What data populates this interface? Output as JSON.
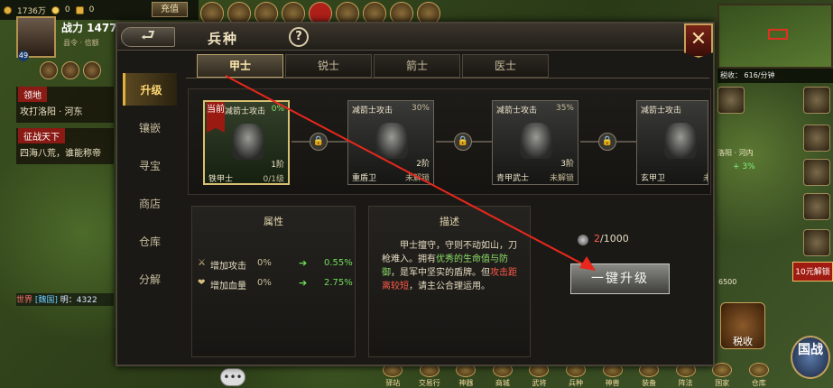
{
  "hud": {
    "silver": "1736万",
    "gold": "0",
    "ingot": "0",
    "recharge_label": "充值",
    "power_label": "战力 1477",
    "official": "县令 · 倍额",
    "level": "49"
  },
  "quests": [
    {
      "title": "领地",
      "text": "攻打洛阳 · 河东"
    },
    {
      "title": "征战天下",
      "text": "四海八荒，谁能称帝"
    }
  ],
  "chat": {
    "tag": "世界",
    "realm": "[魏国]",
    "text": "明：4322"
  },
  "right": {
    "tax": "税收：  616/分钟",
    "coords": "洛阳 · 河内",
    "bonus": "+ 3%",
    "stock": "6500",
    "tax_button": "税收",
    "recharge_ad": "10元解锁",
    "guozhan": "国战"
  },
  "bottom_menu": [
    "驿站",
    "交易行",
    "神器",
    "商城",
    "武将",
    "兵种",
    "神兽",
    "装备",
    "阵法",
    "国家",
    "仓库"
  ],
  "dialog": {
    "back_symbol": "⮐",
    "title": "兵种",
    "help": "?",
    "close": "✕",
    "sidenav": [
      "升级",
      "镶嵌",
      "寻宝",
      "商店",
      "仓库",
      "分解"
    ],
    "tabs": [
      "甲士",
      "锐士",
      "箭士",
      "医士"
    ],
    "current_badge": "当前",
    "units": [
      {
        "buff": "减箭士攻击",
        "pct": "0%",
        "stage": "1阶",
        "name": "铁甲士",
        "status": "0/1级"
      },
      {
        "buff": "减箭士攻击",
        "pct": "30%",
        "stage": "2阶",
        "name": "重盾卫",
        "status": "未解锁"
      },
      {
        "buff": "减箭士攻击",
        "pct": "35%",
        "stage": "3阶",
        "name": "青甲武士",
        "status": "未解锁"
      },
      {
        "buff": "减箭士攻击",
        "pct": "",
        "stage": "",
        "name": "玄甲卫",
        "status": "未"
      }
    ],
    "attr": {
      "heading": "属性",
      "rows": [
        {
          "icon": "⚔",
          "label": "增加攻击",
          "base": "0%",
          "arrow": "➔",
          "next": "0.55%"
        },
        {
          "icon": "❤",
          "label": "增加血量",
          "base": "0%",
          "arrow": "➔",
          "next": "2.75%"
        }
      ]
    },
    "desc": {
      "heading": "描述",
      "p1": "甲士擅守，守则不动如山，刀枪难入。拥有",
      "g": "优秀的生命值与防御",
      "p2": "，是军中坚实的盾牌。但",
      "r": "攻击距离较短",
      "p3": "，请主公合理运用。"
    },
    "cost_have": "2",
    "cost_need": "/1000",
    "upgrade_label": "一键升级"
  },
  "colors": {
    "accent": "#e0b040",
    "annotation": "#e8281c",
    "green": "#8be06a",
    "red": "#ff5a4a"
  }
}
